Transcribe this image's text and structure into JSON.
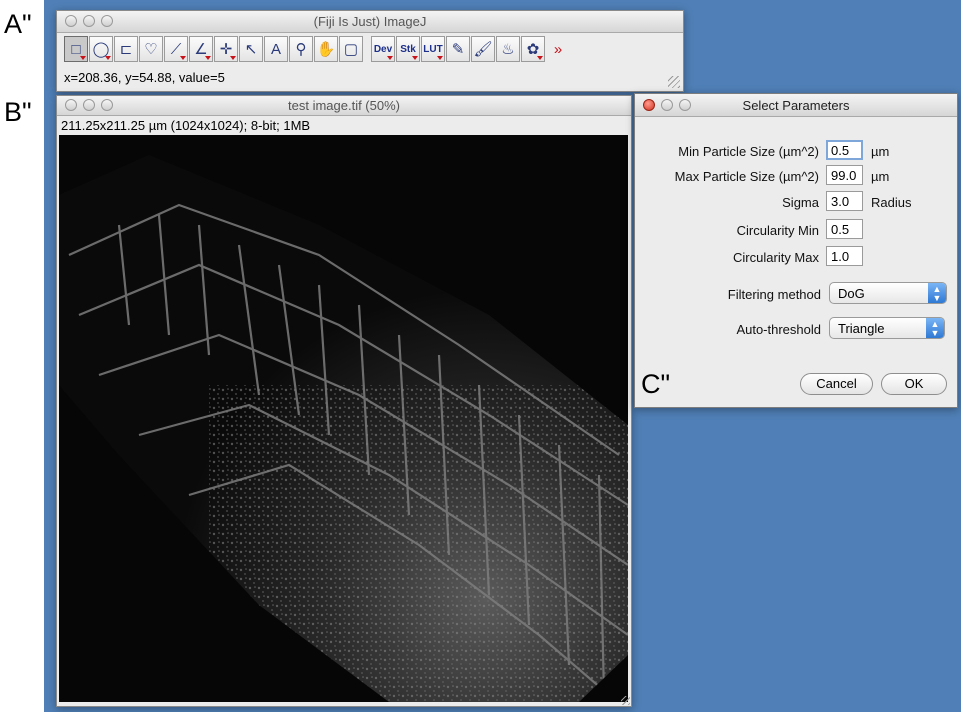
{
  "panel_labels": {
    "a": "A\"",
    "b": "B\"",
    "c": "C\""
  },
  "imagej_toolbar": {
    "title": "(Fiji Is Just) ImageJ",
    "status": "x=208.36, y=54.88, value=5",
    "tools": [
      {
        "name": "rectangle-tool-icon",
        "glyph": "□"
      },
      {
        "name": "oval-tool-icon",
        "glyph": "◯"
      },
      {
        "name": "polygon-tool-icon",
        "glyph": "⊏"
      },
      {
        "name": "freehand-tool-icon",
        "glyph": "♡"
      },
      {
        "name": "line-tool-icon",
        "glyph": "⟋"
      },
      {
        "name": "angle-tool-icon",
        "glyph": "∠"
      },
      {
        "name": "point-tool-icon",
        "glyph": "✛"
      },
      {
        "name": "wand-tool-icon",
        "glyph": "↖"
      },
      {
        "name": "text-tool-icon",
        "glyph": "A"
      },
      {
        "name": "magnifier-tool-icon",
        "glyph": "⚲"
      },
      {
        "name": "hand-tool-icon",
        "glyph": "✋"
      },
      {
        "name": "color-picker-tool-icon",
        "glyph": "▢"
      }
    ],
    "menu_tools": [
      {
        "name": "dev-menu-button",
        "glyph": "Dev"
      },
      {
        "name": "stk-menu-button",
        "glyph": "Stk"
      },
      {
        "name": "lut-menu-button",
        "glyph": "LUT"
      },
      {
        "name": "pencil-tool-icon",
        "glyph": "✎"
      },
      {
        "name": "brush-tool-icon",
        "glyph": "🖌"
      },
      {
        "name": "flood-fill-tool-icon",
        "glyph": "♨"
      },
      {
        "name": "plugin-tool-icon",
        "glyph": "✿"
      },
      {
        "name": "more-tools-icon",
        "glyph": "»"
      }
    ]
  },
  "image_window": {
    "title": "test image.tif (50%)",
    "info": "211.25x211.25 µm (1024x1024); 8-bit; 1MB"
  },
  "dialog": {
    "title": "Select Parameters",
    "fields": [
      {
        "label": "Min Particle Size (µm^2)",
        "value": "0.5",
        "unit": "µm"
      },
      {
        "label": "Max Particle Size (µm^2)",
        "value": "99.0",
        "unit": "µm"
      },
      {
        "label": "Sigma",
        "value": "3.0",
        "unit": "Radius"
      },
      {
        "label": "Circularity Min",
        "value": "0.5",
        "unit": ""
      },
      {
        "label": "Circularity Max",
        "value": "1.0",
        "unit": ""
      }
    ],
    "filtering_method": {
      "label": "Filtering method",
      "value": "DoG"
    },
    "auto_threshold": {
      "label": "Auto-threshold",
      "value": "Triangle"
    },
    "cancel_label": "Cancel",
    "ok_label": "OK"
  }
}
